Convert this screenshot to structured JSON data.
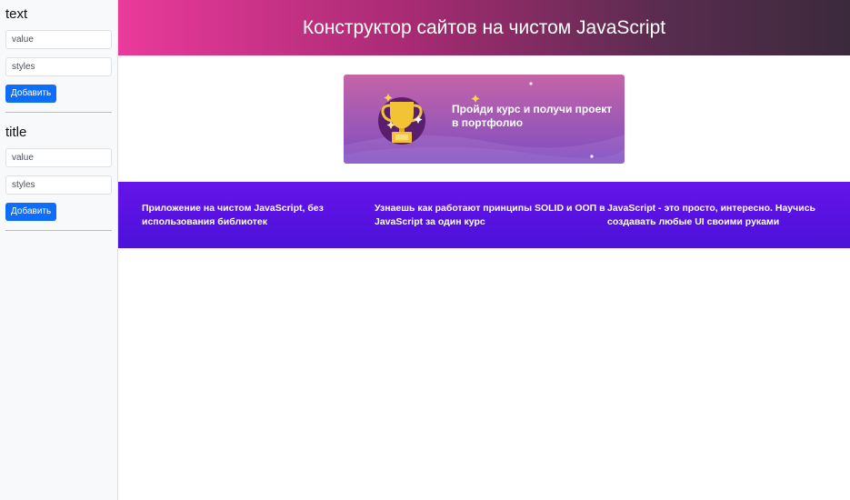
{
  "sidebar": {
    "forms": [
      {
        "title": "text",
        "value_placeholder": "value",
        "styles_placeholder": "styles",
        "submit_label": "Добавить"
      },
      {
        "title": "title",
        "value_placeholder": "value",
        "styles_placeholder": "styles",
        "submit_label": "Добавить"
      }
    ]
  },
  "site": {
    "header_title": "Конструктор сайтов на чистом JavaScript",
    "banner": {
      "text": "Пройди курс и получи проект в портфолио",
      "icon": "trophy-icon"
    },
    "features": [
      "Приложение на чистом JavaScript, без использования библиотек",
      "Узнаешь как работают принципы SOLID и ООП в JavaScript за один курс",
      "JavaScript - это просто, интересно. Научись создавать любые UI своими руками"
    ]
  },
  "colors": {
    "primary_button": "#0d6efd",
    "header_gradient_start": "#ea3a9a",
    "header_gradient_end": "#3b2a3c",
    "features_background": "#5512e0"
  }
}
